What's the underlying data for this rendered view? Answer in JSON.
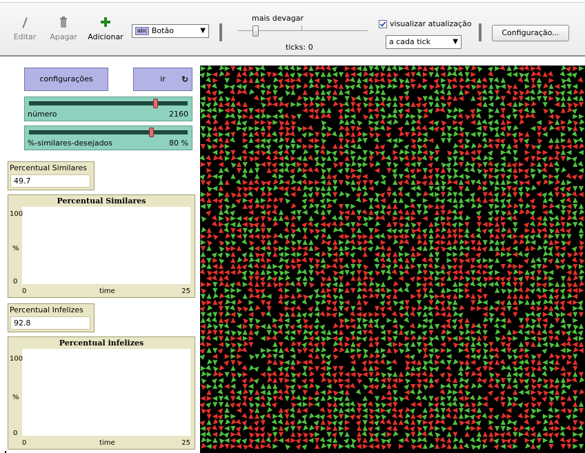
{
  "toolbar": {
    "edit_label": "Editar",
    "delete_label": "Apagar",
    "add_label": "Adicionar",
    "widget_select": "Botão",
    "widget_select_tag": "abc",
    "speed_label": "mais devagar",
    "ticks_label": "ticks: 0",
    "view_updates_label": "visualizar atualização",
    "view_updates_checked": true,
    "update_mode": "a cada tick",
    "settings_label": "Configuração..."
  },
  "buttons": {
    "setup_label": "configurações",
    "go_label": "ir"
  },
  "sliders": [
    {
      "name": "número",
      "value": "2160",
      "fraction": 0.87
    },
    {
      "name": "%-similares-desejados",
      "value": "80 %",
      "fraction": 0.8
    }
  ],
  "monitors": [
    {
      "title": "Percentual Similares",
      "value": "49.7"
    },
    {
      "title": "Percentual Infelizes",
      "value": "92.8"
    }
  ],
  "plots": [
    {
      "title": "Percentual Similares",
      "ymax": "100",
      "ymin": "0",
      "ylabel": "%",
      "xmin": "0",
      "xmax": "25",
      "xlabel": "time"
    },
    {
      "title": "Percentual infelizes",
      "ymax": "100",
      "ymin": "0",
      "ylabel": "%",
      "xmin": "0",
      "xmax": "25",
      "xlabel": "time"
    }
  ],
  "world": {
    "background": "#000000",
    "agent_colors": [
      "#e2312b",
      "#4fbf3f"
    ],
    "icons": [
      "pencil-icon",
      "trash-icon",
      "plus-icon",
      "refresh-icon",
      "checkbox-icon"
    ]
  }
}
